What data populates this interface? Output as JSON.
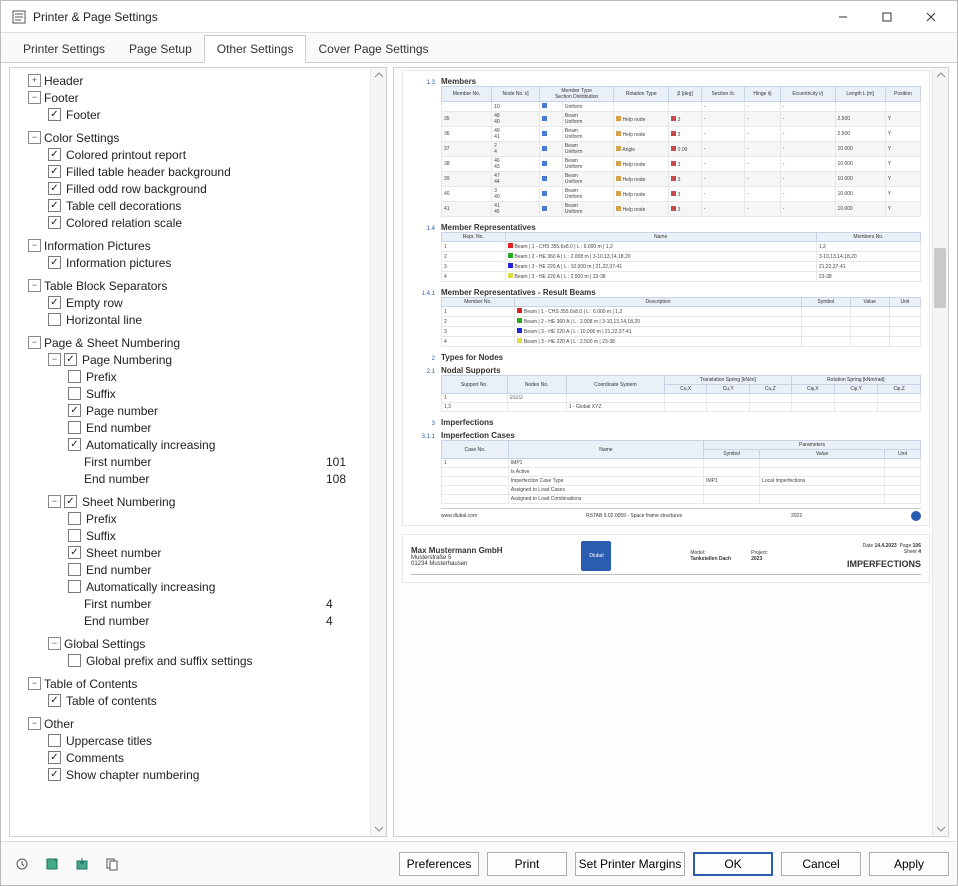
{
  "window": {
    "title": "Printer & Page Settings"
  },
  "tabs": {
    "t1": "Printer Settings",
    "t2": "Page Setup",
    "t3": "Other Settings",
    "t4": "Cover Page Settings"
  },
  "tree": {
    "header": "Header",
    "footer_group": "Footer",
    "footer": "Footer",
    "color_group": "Color Settings",
    "color1": "Colored printout report",
    "color2": "Filled table header background",
    "color3": "Filled odd row background",
    "color4": "Table cell decorations",
    "color5": "Colored relation scale",
    "info_group": "Information Pictures",
    "info1": "Information pictures",
    "tbs_group": "Table Block Separators",
    "tbs1": "Empty row",
    "tbs2": "Horizontal line",
    "psn_group": "Page & Sheet Numbering",
    "pn_group": "Page Numbering",
    "pn_prefix": "Prefix",
    "pn_suffix": "Suffix",
    "pn_page": "Page number",
    "pn_end": "End number",
    "pn_auto": "Automatically increasing",
    "pn_first_lbl": "First number",
    "pn_first_val": "101",
    "pn_end_lbl": "End number",
    "pn_end_val": "108",
    "sn_group": "Sheet Numbering",
    "sn_prefix": "Prefix",
    "sn_suffix": "Suffix",
    "sn_sheet": "Sheet number",
    "sn_end": "End number",
    "sn_auto": "Automatically increasing",
    "sn_first_lbl": "First number",
    "sn_first_val": "4",
    "sn_end_lbl": "End number",
    "sn_end_val": "4",
    "gs_group": "Global Settings",
    "gs1": "Global prefix and suffix settings",
    "toc_group": "Table of Contents",
    "toc1": "Table of contents",
    "other_group": "Other",
    "other1": "Uppercase titles",
    "other2": "Comments",
    "other3": "Show chapter numbering"
  },
  "preview": {
    "s13": "1.3",
    "s13_t": "Members",
    "hdr": {
      "member": "Member No.",
      "node": "Node No. i/j",
      "mtype": "Member Type",
      "sdist": "Section Distribution",
      "rot": "Rotation Type",
      "beta": "β [deg]",
      "section": "Section i/c",
      "hinge": "Hinge i/j",
      "ecc": "Eccentricity i/j",
      "len": "Length L [m]",
      "pos": "Position"
    },
    "rows": [
      {
        "m": "",
        "n": "10",
        "t": "Uniform",
        "rt": "",
        "b": "",
        "s": "-",
        "h": "-",
        "e": "-",
        "l": "",
        "p": ""
      },
      {
        "m": "35",
        "n": "48/40",
        "t": "Beam / Uniform",
        "rt": "Help node",
        "b": "3",
        "s": "-",
        "h": "-",
        "e": "-",
        "l": "2.500",
        "p": "Y"
      },
      {
        "m": "36",
        "n": "49/41",
        "t": "Beam / Uniform",
        "rt": "Help node",
        "b": "3",
        "s": "-",
        "h": "-",
        "e": "-",
        "l": "2.500",
        "p": "Y"
      },
      {
        "m": "37",
        "n": "2/4",
        "t": "Beam / Uniform",
        "rt": "Angle",
        "b": "0.00",
        "s": "-",
        "h": "-",
        "e": "-",
        "l": "10.000",
        "p": "Y"
      },
      {
        "m": "38",
        "n": "46/43",
        "t": "Beam / Uniform",
        "rt": "Help node",
        "b": "3",
        "s": "-",
        "h": "-",
        "e": "-",
        "l": "10.000",
        "p": "Y"
      },
      {
        "m": "39",
        "n": "47/44",
        "t": "Beam / Uniform",
        "rt": "Help node",
        "b": "3",
        "s": "-",
        "h": "-",
        "e": "-",
        "l": "10.000",
        "p": "Y"
      },
      {
        "m": "40",
        "n": "3/40",
        "t": "Beam / Uniform",
        "rt": "Help node",
        "b": "3",
        "s": "-",
        "h": "-",
        "e": "-",
        "l": "10.000",
        "p": "Y"
      },
      {
        "m": "41",
        "n": "41/45",
        "t": "Beam / Uniform",
        "rt": "Help node",
        "b": "3",
        "s": "-",
        "h": "-",
        "e": "-",
        "l": "10.000",
        "p": "Y"
      }
    ],
    "s14": "1.4",
    "s14_t": "Member Representatives",
    "rep_hdr": {
      "no": "Repr. No.",
      "name": "Name",
      "members": "Members No."
    },
    "rep_rows": [
      {
        "n": "1",
        "c": "#d22",
        "name": "Beam | 1 - CHS 355.6x8.0 | L : 6.000 m | 1,2",
        "m": "1,2"
      },
      {
        "n": "2",
        "c": "#2a2",
        "name": "Beam | 2 - HE 360 A | L : 2.008 m | 3-10,13,14,18,20",
        "m": "3-10,13,14,18,20"
      },
      {
        "n": "3",
        "c": "#22d",
        "name": "Beam | 3 - HE 220 A | L : 10.000 m | 21,22,37-41",
        "m": "21,22,37-41"
      },
      {
        "n": "4",
        "c": "#dd4",
        "name": "Beam | 3 - HE 220 A | L : 2.500 m | 23-38",
        "m": "23-38"
      }
    ],
    "s141": "1.4.1",
    "s141_t": "Member Representatives - Result Beams",
    "rb_hdr": {
      "no": "Member No.",
      "desc": "Description",
      "sym": "Symbol",
      "val": "Value",
      "unit": "Unit"
    },
    "s2": "2",
    "s2_t": "Types for Nodes",
    "s21": "2.1",
    "s21_t": "Nodal Supports",
    "ns_hdr": {
      "sup": "Support No.",
      "nodes": "Nodes No.",
      "cs": "Coordinate System",
      "ts": "Translation Spring [kN/m]",
      "rs": "Rotation Spring [kNm/rad]",
      "cux": "Cu,X",
      "cuy": "Cu,Y",
      "cuz": "Cu,Z",
      "cpx": "Cφ,X",
      "cpy": "Cφ,Y",
      "cpz": "Cφ,Z"
    },
    "ns_row": {
      "n": "1,3",
      "nodes": "☑☑☑",
      "cs": "1 - Global XYZ"
    },
    "s3": "3",
    "s3_t": "Imperfections",
    "s311": "3.1.1",
    "s311_t": "Imperfection Cases",
    "ic_hdr": {
      "cno": "Case No.",
      "name": "Name",
      "params": "Parameters",
      "sym": "Symbol",
      "val": "Value",
      "unit": "Unit"
    },
    "ic_rows": {
      "r1": "Is Active",
      "r2": "Imperfection Case Type",
      "r3": "Assigned to Load Cases",
      "r4": "Assigned to Load Combinations",
      "v2": "Local Imperfections"
    },
    "footer": {
      "site": "www.dlubal.com",
      "ver": "RSTAB 9.02.0059 - Space frame structures",
      "year": "2022"
    },
    "pg2": {
      "company": "Max Mustermann GmbH",
      "addr1": "Musterstraße 5",
      "addr2": "01234 Musterhausen",
      "model_lbl": "Model:",
      "model": "Tankstellen Dach",
      "project_lbl": "Project:",
      "project": "2023",
      "date_lbl": "Date",
      "date": "14.4.2023",
      "page_lbl": "Page",
      "page": "106",
      "sheet_lbl": "Sheet",
      "sheet": "4",
      "title": "IMPERFECTIONS",
      "logo": "Dlubal"
    }
  },
  "buttons": {
    "pref": "Preferences",
    "print": "Print",
    "margins": "Set Printer Margins",
    "ok": "OK",
    "cancel": "Cancel",
    "apply": "Apply"
  }
}
